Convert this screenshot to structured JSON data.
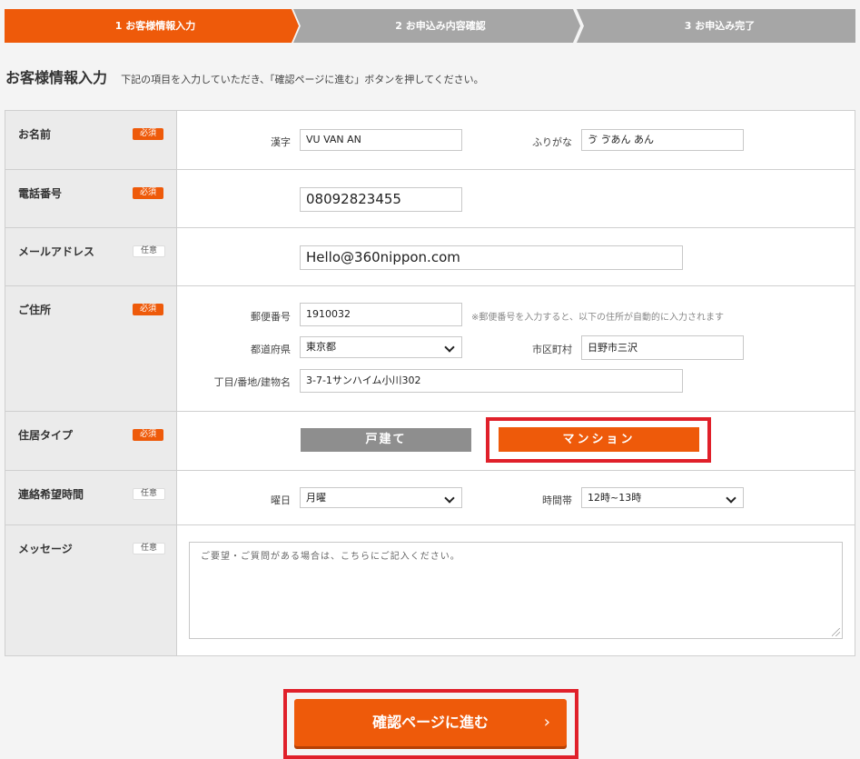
{
  "steps": [
    {
      "label": "1 お客様情報入力"
    },
    {
      "label": "2 お申込み内容確認"
    },
    {
      "label": "3 お申込み完了"
    }
  ],
  "heading": {
    "title": "お客様情報入力",
    "description": "下記の項目を入力していただき、「確認ページに進む」ボタンを押してください。"
  },
  "badges": {
    "required": "必須",
    "optional": "任意"
  },
  "name": {
    "label": "お名前",
    "kanji_label": "漢字",
    "kanji_value": "VU VAN AN",
    "furigana_label": "ふりがな",
    "furigana_value": "ゔ ゔあん あん"
  },
  "phone": {
    "label": "電話番号",
    "value": "08092823455"
  },
  "email": {
    "label": "メールアドレス",
    "value": "Hello@360nippon.com"
  },
  "address": {
    "label": "ご住所",
    "postal_label": "郵便番号",
    "postal_value": "1910032",
    "postal_note": "※郵便番号を入力すると、以下の住所が自動的に入力されます",
    "prefecture_label": "都道府県",
    "prefecture_value": "東京都",
    "city_label": "市区町村",
    "city_value": "日野市三沢",
    "street_label": "丁目/番地/建物名",
    "street_value": "3-7-1サンハイム小川302"
  },
  "housing": {
    "label": "住居タイプ",
    "option_detached": "戸建て",
    "option_mansion": "マンション"
  },
  "contact_time": {
    "label": "連絡希望時間",
    "day_label": "曜日",
    "day_value": "月曜",
    "time_label": "時間帯",
    "time_value": "12時~13時"
  },
  "message": {
    "label": "メッセージ",
    "placeholder": "ご要望・ご質問がある場合は、こちらにご記入ください。"
  },
  "submit": {
    "label": "確認ページに進む",
    "arrow": "›"
  },
  "colors": {
    "accent": "#ee5a0a",
    "inactive_step": "#a6a6a6",
    "highlight": "#e0202a"
  }
}
